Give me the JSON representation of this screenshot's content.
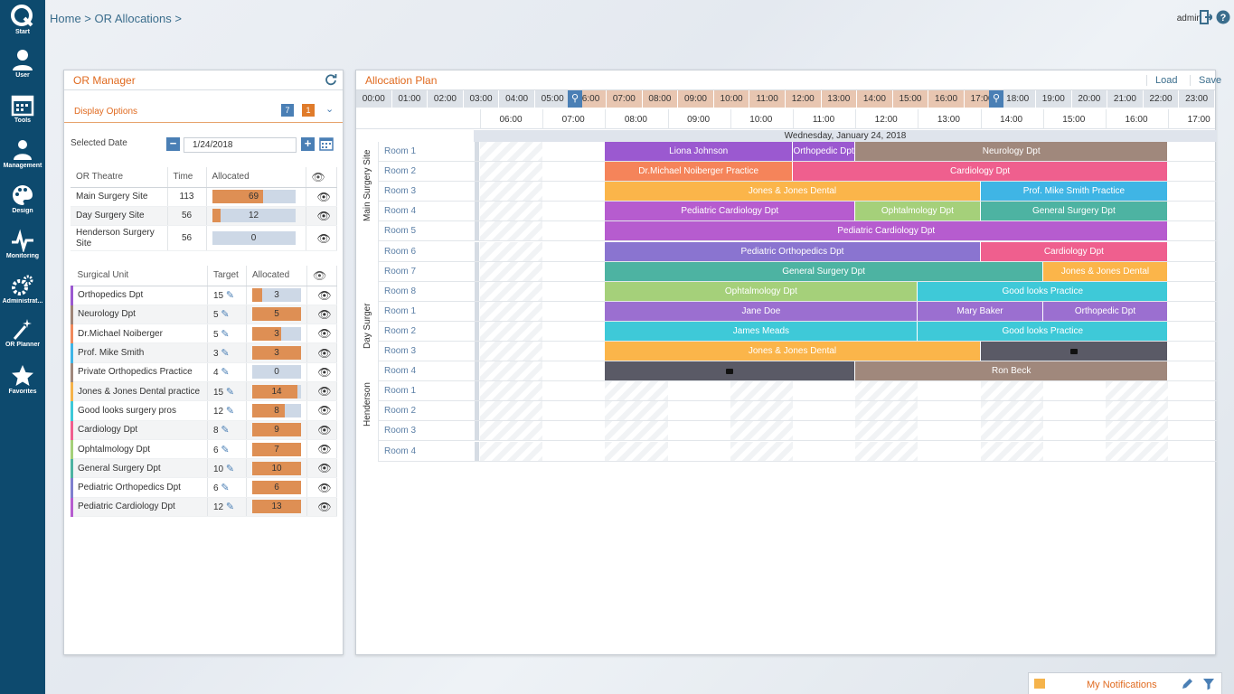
{
  "nav": {
    "items": [
      {
        "label": "Start",
        "icon": "logo-q-icon"
      },
      {
        "label": "User",
        "icon": "user-icon"
      },
      {
        "label": "Tools",
        "icon": "calendar-icon"
      },
      {
        "label": "Management",
        "icon": "people-icon"
      },
      {
        "label": "Design",
        "icon": "palette-icon"
      },
      {
        "label": "Monitoring",
        "icon": "pulse-icon"
      },
      {
        "label": "Administrat...",
        "icon": "gears-icon"
      },
      {
        "label": "OR Planner",
        "icon": "wand-icon"
      },
      {
        "label": "Favorites",
        "icon": "star-icon"
      }
    ]
  },
  "header": {
    "breadcrumb": "Home > OR Allocations >",
    "user": "admin"
  },
  "or_manager": {
    "title": "OR Manager",
    "display_options": "Display Options",
    "badge_date": "7",
    "badge_count": "1",
    "selected_date_label": "Selected Date",
    "selected_date": "1/24/2018",
    "theatre_headers": [
      "OR Theatre",
      "Time",
      "Allocated"
    ],
    "theatres": [
      {
        "name": "Main Surgery Site",
        "time": "113",
        "allocated": 69,
        "allocated_label": "69"
      },
      {
        "name": "Day Surgery Site",
        "time": "56",
        "allocated": 12,
        "allocated_label": "12"
      },
      {
        "name": "Henderson Surgery Site",
        "time": "56",
        "allocated": 0,
        "allocated_label": "0"
      }
    ],
    "unit_headers": [
      "Surgical Unit",
      "Target",
      "Allocated"
    ],
    "units": [
      {
        "name": "Orthopedics Dpt",
        "target": "15",
        "allocated": "3",
        "color": "#9b59d0"
      },
      {
        "name": "Neurology Dpt",
        "target": "5",
        "allocated": "5",
        "color": "#9e8477"
      },
      {
        "name": "Dr.Michael Noiberger",
        "target": "5",
        "allocated": "3",
        "color": "#f08a5d"
      },
      {
        "name": "Prof. Mike Smith",
        "target": "3",
        "allocated": "3",
        "color": "#3fb5e5"
      },
      {
        "name": "Private Orthopedics Practice",
        "target": "4",
        "allocated": "0",
        "color": "#a0887c"
      },
      {
        "name": "Jones & Jones Dental practice",
        "target": "15",
        "allocated": "14",
        "color": "#f5b34b"
      },
      {
        "name": "Good looks surgery pros",
        "target": "12",
        "allocated": "8",
        "color": "#3ec9d8"
      },
      {
        "name": "Cardiology Dpt",
        "target": "8",
        "allocated": "9",
        "color": "#ef5f8e"
      },
      {
        "name": "Ophtalmology Dpt",
        "target": "6",
        "allocated": "7",
        "color": "#a5d07a"
      },
      {
        "name": "General Surgery Dpt",
        "target": "10",
        "allocated": "10",
        "color": "#4db3a2"
      },
      {
        "name": "Pediatric Orthopedics Dpt",
        "target": "6",
        "allocated": "6",
        "color": "#7f7fcf"
      },
      {
        "name": "Pediatric Cardiology Dpt",
        "target": "12",
        "allocated": "13",
        "color": "#b65ccf"
      }
    ]
  },
  "allocation_plan": {
    "title": "Allocation Plan",
    "load": "Load",
    "save": "Save",
    "overview_hours": [
      "00:00",
      "01:00",
      "02:00",
      "03:00",
      "04:00",
      "05:00",
      "06:00",
      "07:00",
      "08:00",
      "09:00",
      "10:00",
      "11:00",
      "12:00",
      "13:00",
      "14:00",
      "15:00",
      "16:00",
      "17:00",
      "18:00",
      "19:00",
      "20:00",
      "21:00",
      "22:00",
      "23:00"
    ],
    "ticks": [
      "06:00",
      "07:00",
      "08:00",
      "09:00",
      "10:00",
      "11:00",
      "12:00",
      "13:00",
      "14:00",
      "15:00",
      "16:00",
      "17:00"
    ],
    "date_header": "Wednesday, January 24, 2018",
    "sites": [
      "Main Surgery Site",
      "Day Surger",
      "Henderson"
    ],
    "rooms": [
      {
        "site": 0,
        "name": "Room 1",
        "bands": [
          {
            "label": "Liona Johnson",
            "start": 8,
            "end": 11,
            "color": "#9b59d0"
          },
          {
            "label": "Orthopedic Dpt",
            "start": 11,
            "end": 12,
            "color": "#9b59d0"
          },
          {
            "label": "Neurology Dpt",
            "start": 12,
            "end": 17,
            "color": "#a0887c"
          }
        ]
      },
      {
        "site": 0,
        "name": "Room 2",
        "bands": [
          {
            "label": "Dr.Michael Noiberger Practice",
            "start": 8,
            "end": 11,
            "color": "#f5845a"
          },
          {
            "label": "Cardiology Dpt",
            "start": 11,
            "end": 17,
            "color": "#ef5f8e"
          }
        ]
      },
      {
        "site": 0,
        "name": "Room 3",
        "bands": [
          {
            "label": "Jones & Jones Dental",
            "start": 8,
            "end": 14,
            "color": "#fbb54a"
          },
          {
            "label": "Prof. Mike Smith Practice",
            "start": 14,
            "end": 17,
            "color": "#3fb5e5"
          }
        ]
      },
      {
        "site": 0,
        "name": "Room 4",
        "bands": [
          {
            "label": "Pediatric Cardiology Dpt",
            "start": 8,
            "end": 12,
            "color": "#b65ccf"
          },
          {
            "label": "Ophtalmology Dpt",
            "start": 12,
            "end": 14,
            "color": "#a5d07a"
          },
          {
            "label": "General Surgery Dpt",
            "start": 14,
            "end": 17,
            "color": "#4db3a2"
          }
        ]
      },
      {
        "site": 0,
        "name": "Room 5",
        "bands": [
          {
            "label": "Pediatric Cardiology Dpt",
            "start": 8,
            "end": 17,
            "color": "#b65ccf"
          }
        ]
      },
      {
        "site": 0,
        "name": "Room 6",
        "bands": [
          {
            "label": "Pediatric Orthopedics Dpt",
            "start": 8,
            "end": 14,
            "color": "#8a74d0"
          },
          {
            "label": "Cardiology Dpt",
            "start": 14,
            "end": 17,
            "color": "#ef5f8e"
          }
        ]
      },
      {
        "site": 0,
        "name": "Room 7",
        "bands": [
          {
            "label": "General Surgery Dpt",
            "start": 8,
            "end": 15,
            "color": "#4db3a2"
          },
          {
            "label": "Jones & Jones Dental",
            "start": 15,
            "end": 17,
            "color": "#fbb54a"
          }
        ]
      },
      {
        "site": 0,
        "name": "Room 8",
        "bands": [
          {
            "label": "Ophtalmology Dpt",
            "start": 8,
            "end": 13,
            "color": "#a5d07a"
          },
          {
            "label": "Good looks Practice",
            "start": 13,
            "end": 17,
            "color": "#3ec9d8"
          }
        ]
      },
      {
        "site": 1,
        "name": "Room 1",
        "bands": [
          {
            "label": "Jane Doe",
            "start": 8,
            "end": 13,
            "color": "#9b6fd0"
          },
          {
            "label": "Mary Baker",
            "start": 13,
            "end": 15,
            "color": "#9b6fd0"
          },
          {
            "label": "Orthopedic Dpt",
            "start": 15,
            "end": 17,
            "color": "#9b6fd0"
          }
        ]
      },
      {
        "site": 1,
        "name": "Room 2",
        "bands": [
          {
            "label": "James Meads",
            "start": 8,
            "end": 13,
            "color": "#3ec9d8"
          },
          {
            "label": "Good looks Practice",
            "start": 13,
            "end": 17,
            "color": "#3ec9d8"
          }
        ]
      },
      {
        "site": 1,
        "name": "Room 3",
        "bands": [
          {
            "label": "Jones & Jones Dental",
            "start": 8,
            "end": 14,
            "color": "#fbb54a"
          },
          {
            "label": "",
            "start": 14,
            "end": 17,
            "color": "#5a5a66",
            "lock": true
          }
        ]
      },
      {
        "site": 1,
        "name": "Room 4",
        "bands": [
          {
            "label": "",
            "start": 8,
            "end": 12,
            "color": "#5a5a66",
            "lock": true
          },
          {
            "label": "Ron Beck",
            "start": 12,
            "end": 17,
            "color": "#a0887c"
          }
        ]
      },
      {
        "site": 2,
        "name": "Room 1",
        "bands": []
      },
      {
        "site": 2,
        "name": "Room 2",
        "bands": []
      },
      {
        "site": 2,
        "name": "Room 3",
        "bands": []
      },
      {
        "site": 2,
        "name": "Room 4",
        "bands": []
      }
    ]
  },
  "notifications": {
    "title": "My Notifications"
  }
}
